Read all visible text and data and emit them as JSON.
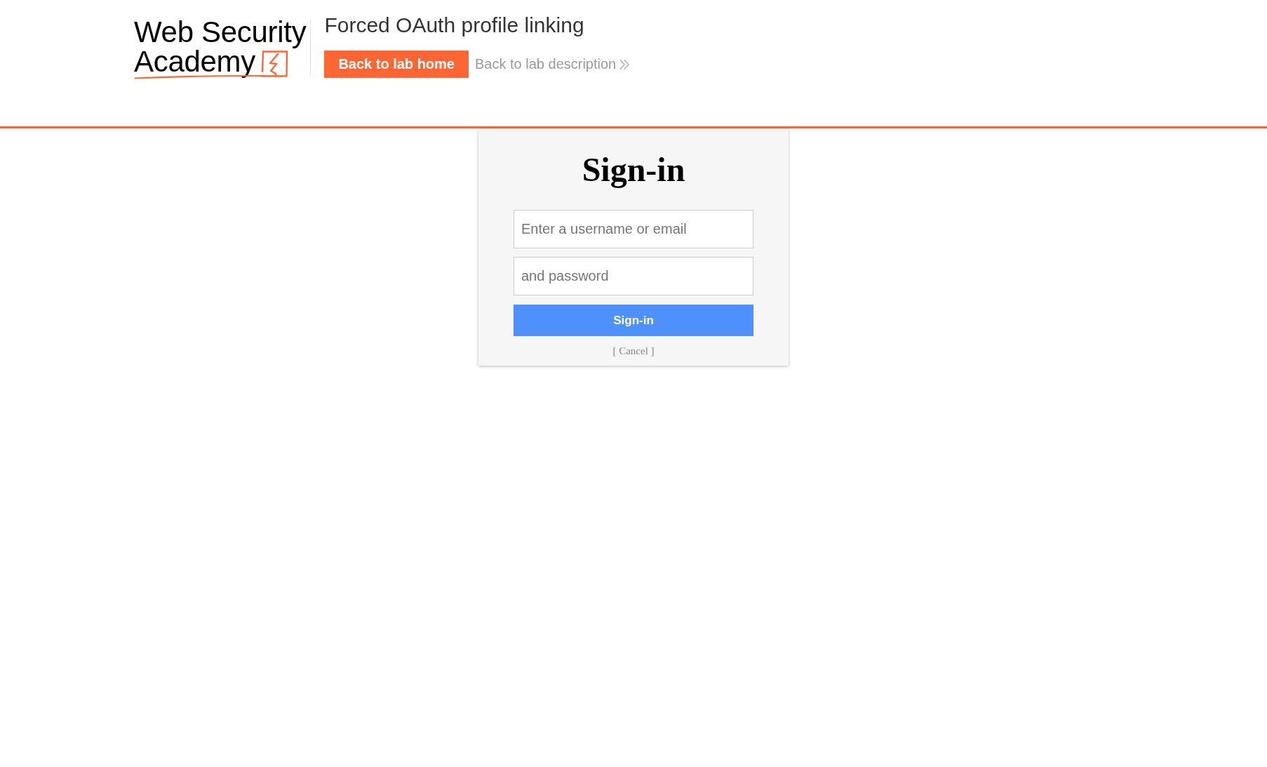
{
  "header": {
    "logo": {
      "line_1": "Web Security",
      "line_2": "Academy"
    },
    "lab_title": "Forced OAuth profile linking",
    "back_to_lab_home": "Back to lab home",
    "back_to_lab_description": "Back to lab description"
  },
  "signin": {
    "title": "Sign-in",
    "fields": [
      {
        "placeholder": "Enter a username or email"
      },
      {
        "placeholder": "and password"
      }
    ],
    "submit": "Sign-in",
    "cancel": "[ Cancel ]"
  }
}
